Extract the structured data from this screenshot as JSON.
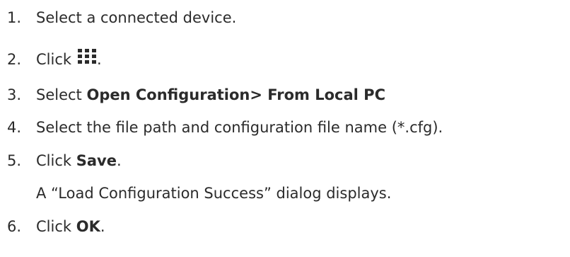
{
  "steps": [
    {
      "num": "1.",
      "text": "Select a connected device."
    },
    {
      "num": "2.",
      "prefix": "Click",
      "icon": "grid-menu-icon",
      "suffix": "."
    },
    {
      "num": "3.",
      "prefix": "Select",
      "bold": "Open Configuration> From Local PC"
    },
    {
      "num": "4.",
      "text": "Select the file path and configuration file name (*.cfg)."
    },
    {
      "num": "5.",
      "prefix": "Click",
      "bold": "Save",
      "suffix": "."
    },
    {
      "note": "A “Load Configuration Success” dialog displays."
    },
    {
      "num": "6.",
      "prefix": "Click",
      "bold": "OK",
      "suffix": "."
    }
  ],
  "colors": {
    "text": "#2b2b2b"
  }
}
